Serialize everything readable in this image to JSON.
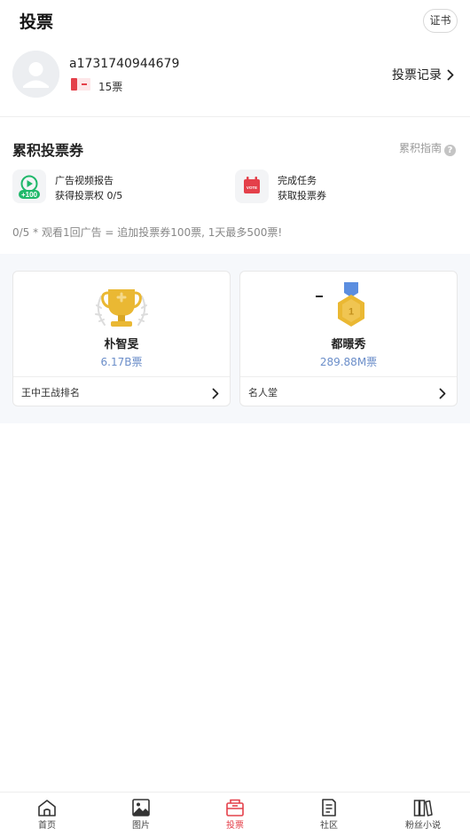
{
  "header": {
    "title": "投票",
    "cert_label": "证书"
  },
  "profile": {
    "username": "a1731740944679",
    "ticket_count": "15票",
    "vote_record_label": "投票记录"
  },
  "accumulate": {
    "title": "累积投票券",
    "guide_label": "累积指南",
    "tasks": [
      {
        "line1": "广告视频报告",
        "line2": "获得投票权 0/5",
        "badge": "+100",
        "icon": "play-video-icon"
      },
      {
        "line1": "完成任务",
        "line2": "获取投票券",
        "badge": "VOTE",
        "icon": "calendar-vote-icon"
      }
    ],
    "note": "0/5 * 观看1回广告 = 追加投票券100票, 1天最多500票!"
  },
  "cards": [
    {
      "name": "朴智旻",
      "votes": "6.17B票",
      "footer": "王中王战排名",
      "icon": "trophy-icon"
    },
    {
      "name": "都暻秀",
      "votes": "289.88M票",
      "footer": "名人堂",
      "medal_number": "1",
      "icon": "medal-icon"
    }
  ],
  "tabs": [
    {
      "label": "首页",
      "icon": "home-icon"
    },
    {
      "label": "图片",
      "icon": "image-icon"
    },
    {
      "label": "投票",
      "icon": "vote-box-icon",
      "active": true
    },
    {
      "label": "社区",
      "icon": "document-icon"
    },
    {
      "label": "粉丝小说",
      "icon": "books-icon"
    }
  ],
  "colors": {
    "accent": "#e4404a",
    "vote_blue": "#6b8ec9",
    "task_green": "#1fb86a",
    "gold": "#e9b531"
  }
}
